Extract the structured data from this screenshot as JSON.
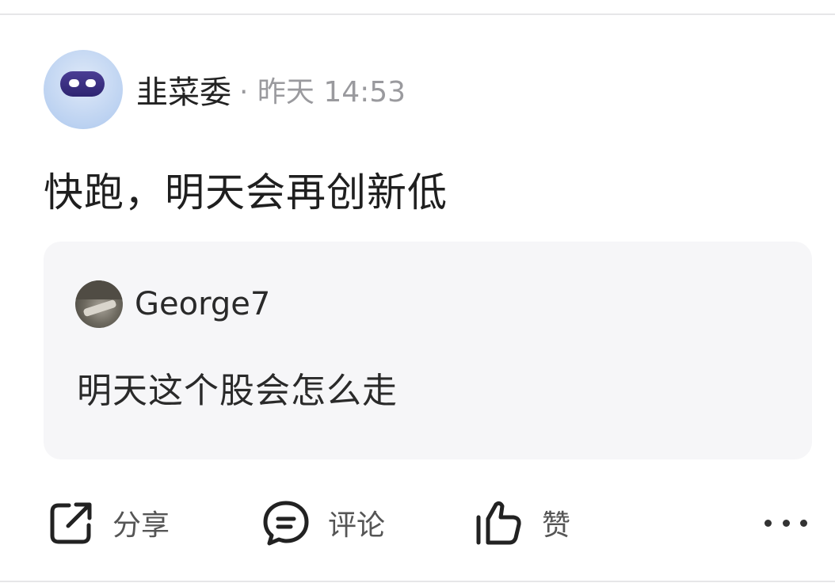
{
  "post": {
    "author": "韭菜委",
    "meta": "· 昨天 14:53",
    "content": "快跑，明天会再创新低"
  },
  "quote": {
    "author": "George7",
    "content": "明天这个股会怎么走"
  },
  "actions": {
    "share_label": "分享",
    "comment_label": "评论",
    "like_label": "赞",
    "share_icon": "share-icon",
    "comment_icon": "comment-icon",
    "like_icon": "thumbs-up-icon",
    "more_icon": "more-icon"
  },
  "colors": {
    "background": "#ffffff",
    "quote_background": "#f6f6f8",
    "meta_text": "#9a9a9e",
    "visor": "#2e2571"
  }
}
